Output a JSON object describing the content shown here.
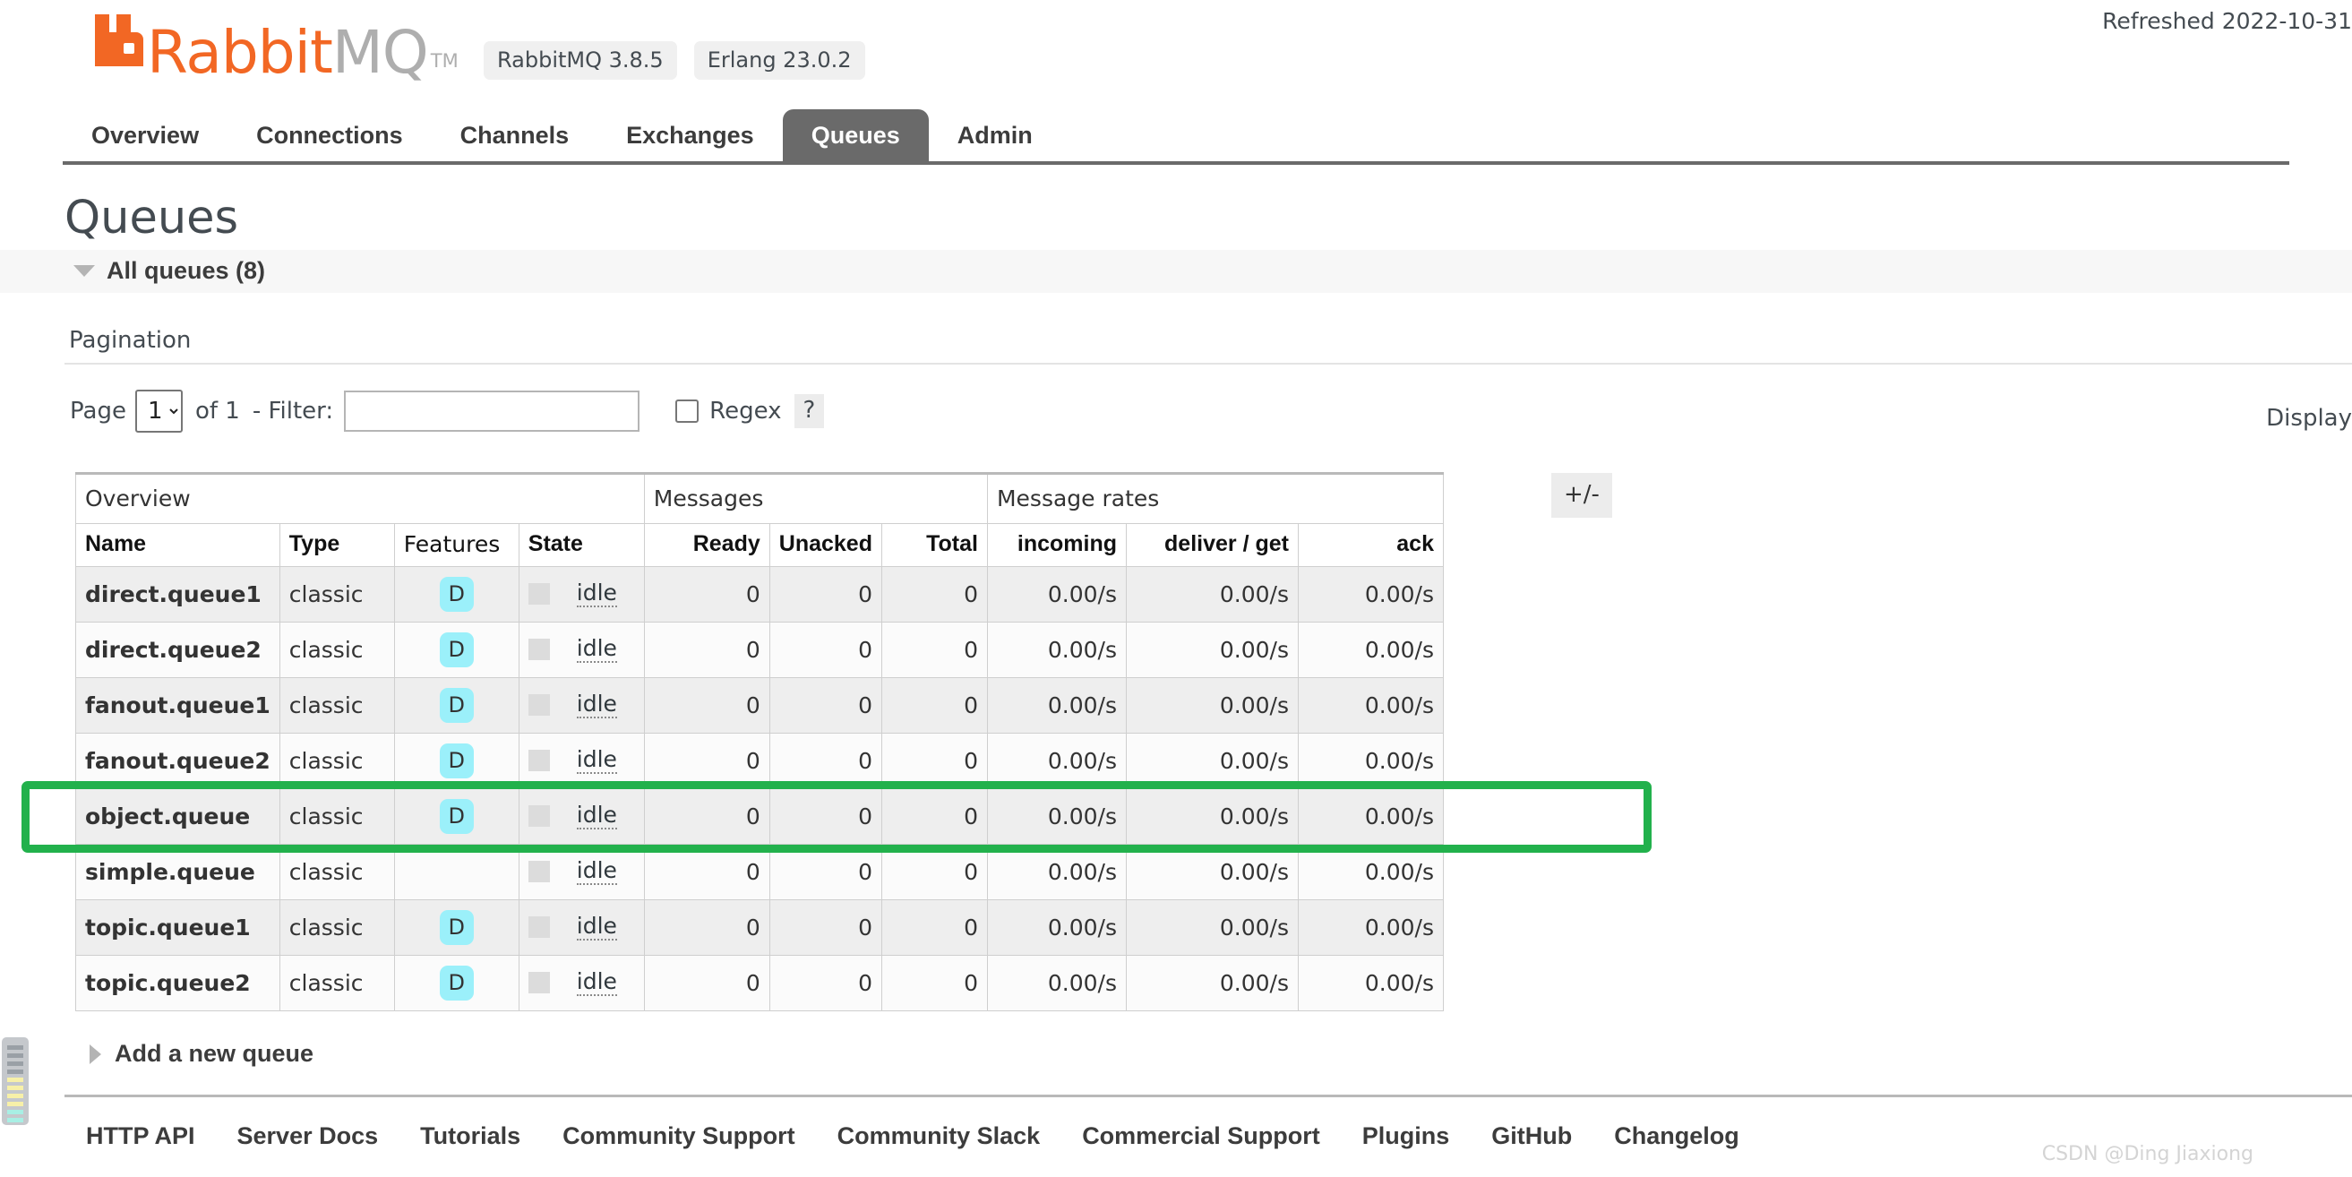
{
  "header": {
    "logo_rabbit": "Rabbit",
    "logo_mq": "MQ",
    "logo_tm": "TM",
    "badges": [
      "RabbitMQ 3.8.5",
      "Erlang 23.0.2"
    ],
    "refreshed": "Refreshed 2022-10-31",
    "brand_color": "#f26724"
  },
  "nav": {
    "tabs": [
      {
        "label": "Overview",
        "active": false
      },
      {
        "label": "Connections",
        "active": false
      },
      {
        "label": "Channels",
        "active": false
      },
      {
        "label": "Exchanges",
        "active": false
      },
      {
        "label": "Queues",
        "active": true
      },
      {
        "label": "Admin",
        "active": false
      }
    ]
  },
  "page": {
    "title": "Queues",
    "section_label": "All queues (8)",
    "pagination_heading": "Pagination",
    "display_label": "Display"
  },
  "pagination": {
    "page_label": "Page",
    "page_value": "1",
    "page_options": [
      "1"
    ],
    "of_label": "of 1",
    "filter_label": "- Filter:",
    "filter_value": "",
    "regex_label": "Regex",
    "regex_checked": false,
    "help_label": "?"
  },
  "table": {
    "group_headers": [
      {
        "label": "Overview",
        "span": 4
      },
      {
        "label": "Messages",
        "span": 3
      },
      {
        "label": "Message rates",
        "span": 3
      }
    ],
    "plus_minus": "+/-",
    "columns": [
      "Name",
      "Type",
      "Features",
      "State",
      "Ready",
      "Unacked",
      "Total",
      "incoming",
      "deliver / get",
      "ack"
    ],
    "state_text": "idle",
    "feature_badge": "D",
    "rows": [
      {
        "name": "direct.queue1",
        "type": "classic",
        "features": "D",
        "state": "idle",
        "ready": "0",
        "unacked": "0",
        "total": "0",
        "incoming": "0.00/s",
        "deliver_get": "0.00/s",
        "ack": "0.00/s"
      },
      {
        "name": "direct.queue2",
        "type": "classic",
        "features": "D",
        "state": "idle",
        "ready": "0",
        "unacked": "0",
        "total": "0",
        "incoming": "0.00/s",
        "deliver_get": "0.00/s",
        "ack": "0.00/s"
      },
      {
        "name": "fanout.queue1",
        "type": "classic",
        "features": "D",
        "state": "idle",
        "ready": "0",
        "unacked": "0",
        "total": "0",
        "incoming": "0.00/s",
        "deliver_get": "0.00/s",
        "ack": "0.00/s"
      },
      {
        "name": "fanout.queue2",
        "type": "classic",
        "features": "D",
        "state": "idle",
        "ready": "0",
        "unacked": "0",
        "total": "0",
        "incoming": "0.00/s",
        "deliver_get": "0.00/s",
        "ack": "0.00/s"
      },
      {
        "name": "object.queue",
        "type": "classic",
        "features": "D",
        "state": "idle",
        "ready": "0",
        "unacked": "0",
        "total": "0",
        "incoming": "0.00/s",
        "deliver_get": "0.00/s",
        "ack": "0.00/s",
        "highlighted": true
      },
      {
        "name": "simple.queue",
        "type": "classic",
        "features": "",
        "state": "idle",
        "ready": "0",
        "unacked": "0",
        "total": "0",
        "incoming": "0.00/s",
        "deliver_get": "0.00/s",
        "ack": "0.00/s"
      },
      {
        "name": "topic.queue1",
        "type": "classic",
        "features": "D",
        "state": "idle",
        "ready": "0",
        "unacked": "0",
        "total": "0",
        "incoming": "0.00/s",
        "deliver_get": "0.00/s",
        "ack": "0.00/s"
      },
      {
        "name": "topic.queue2",
        "type": "classic",
        "features": "D",
        "state": "idle",
        "ready": "0",
        "unacked": "0",
        "total": "0",
        "incoming": "0.00/s",
        "deliver_get": "0.00/s",
        "ack": "0.00/s"
      }
    ],
    "highlight_color": "#22b14c"
  },
  "add_queue": {
    "label": "Add a new queue"
  },
  "footer": {
    "links": [
      "HTTP API",
      "Server Docs",
      "Tutorials",
      "Community Support",
      "Community Slack",
      "Commercial Support",
      "Plugins",
      "GitHub",
      "Changelog"
    ]
  },
  "watermark": "CSDN @Ding Jiaxiong"
}
